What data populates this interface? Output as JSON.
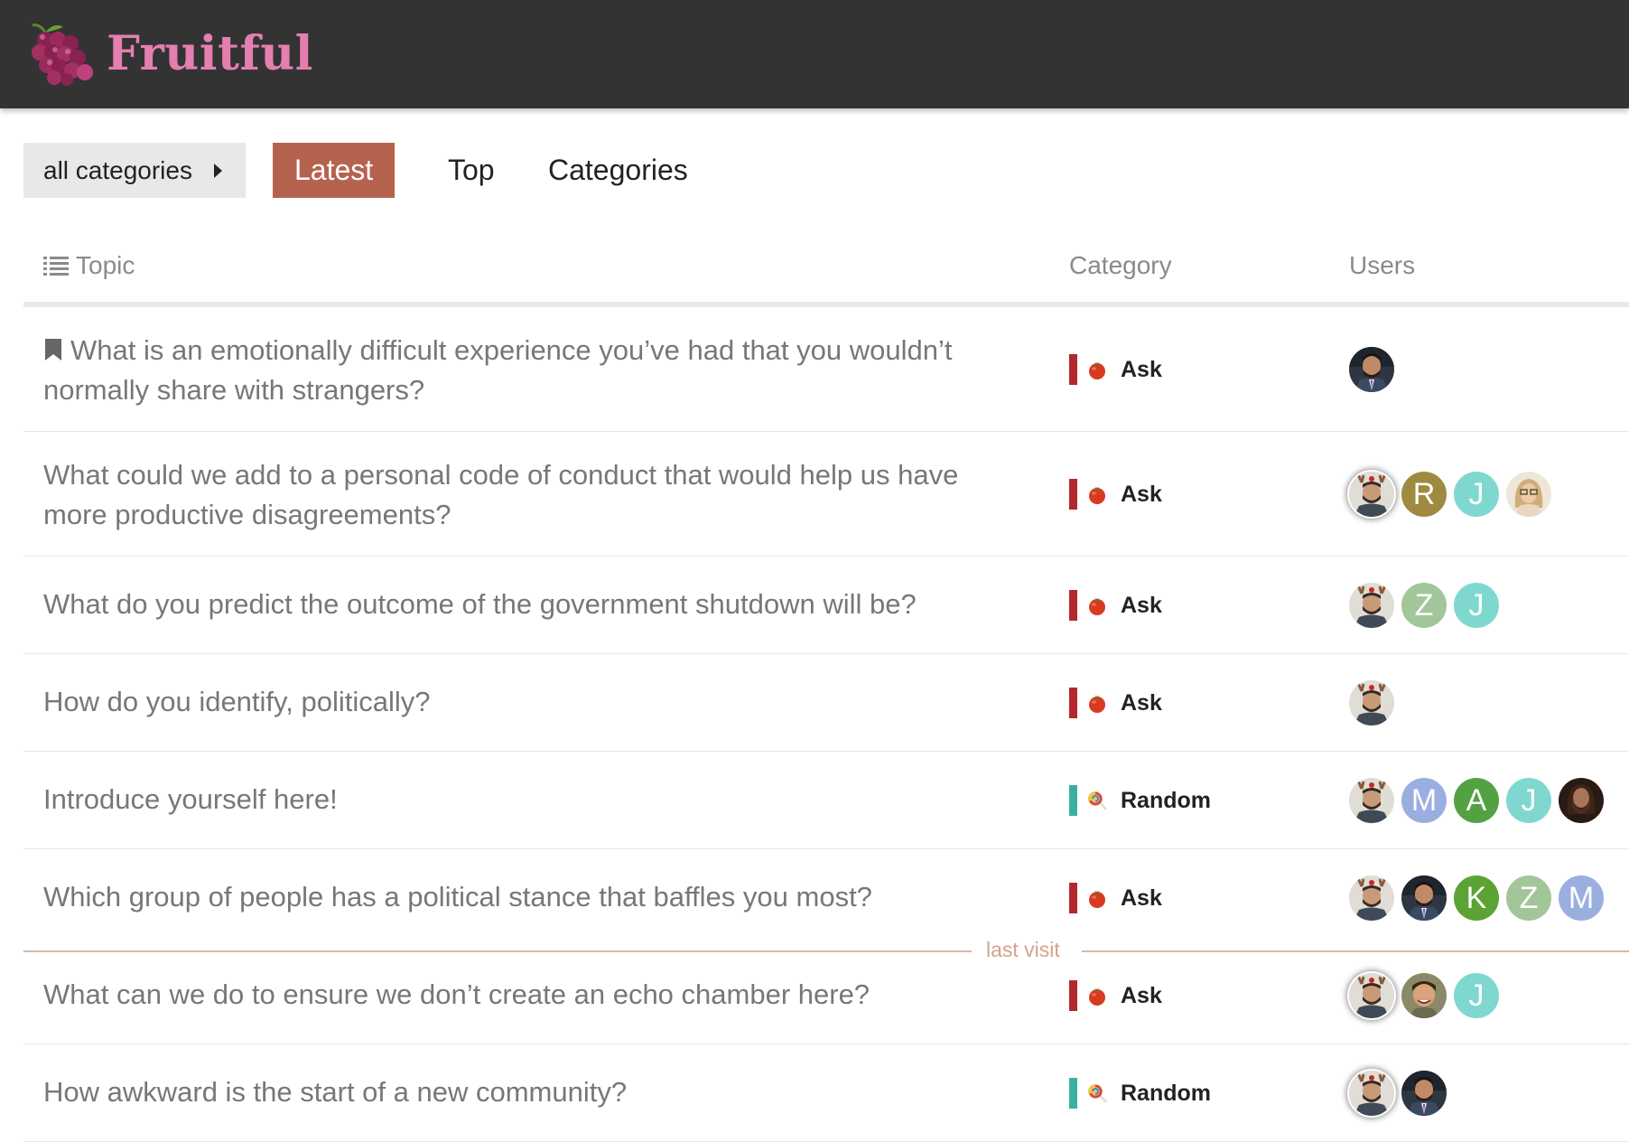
{
  "site": {
    "name": "Fruitful",
    "logo_icon": "grapes-logo",
    "brand_color": "#e47fb0",
    "header_bg": "#333333"
  },
  "nav": {
    "category_filter": "all categories",
    "tabs": [
      {
        "label": "Latest",
        "active": true
      },
      {
        "label": "Top",
        "active": false
      },
      {
        "label": "Categories",
        "active": false
      }
    ],
    "active_color": "#b5634f"
  },
  "table": {
    "headers": {
      "topic": "Topic",
      "category": "Category",
      "users": "Users"
    },
    "last_visit_label": "last visit",
    "topics": [
      {
        "title": "What is an emotionally difficult experience you’ve had that you wouldn’t normally share with strangers?",
        "bookmarked": true,
        "category": "Ask",
        "users": [
          "photo-suit"
        ]
      },
      {
        "title": "What could we add to a personal code of conduct that would help us have more productive disagreements?",
        "bookmarked": false,
        "category": "Ask",
        "users": [
          "photo-antlers-op",
          "R",
          "J",
          "photo-woman"
        ]
      },
      {
        "title": "What do you predict the outcome of the government shutdown will be?",
        "bookmarked": false,
        "category": "Ask",
        "users": [
          "photo-antlers",
          "Z",
          "J"
        ]
      },
      {
        "title": "How do you identify, politically?",
        "bookmarked": false,
        "category": "Ask",
        "users": [
          "photo-antlers"
        ]
      },
      {
        "title": "Introduce yourself here!",
        "bookmarked": false,
        "category": "Random",
        "users": [
          "photo-antlers",
          "M",
          "A",
          "J",
          "photo-beard"
        ]
      },
      {
        "title": "Which group of people has a political stance that baffles you most?",
        "bookmarked": false,
        "category": "Ask",
        "users": [
          "photo-antlers",
          "photo-suit",
          "K",
          "Z",
          "M"
        ]
      },
      {
        "title": "What can we do to ensure we don’t create an echo chamber here?",
        "bookmarked": false,
        "category": "Ask",
        "users": [
          "photo-antlers-op",
          "photo-child",
          "J"
        ]
      },
      {
        "title": "How awkward is the start of a new community?",
        "bookmarked": false,
        "category": "Random",
        "users": [
          "photo-antlers-op",
          "photo-suit"
        ]
      }
    ]
  },
  "categories": {
    "Ask": {
      "color": "#b3282d",
      "icon": "tomato-icon"
    },
    "Random": {
      "color": "#3ab0a2",
      "icon": "lollipop-icon"
    }
  },
  "avatar_colors": {
    "R": "#9e8b3f",
    "J": "#7fd8cf",
    "Z": "#a2c699",
    "M": "#9aaee0",
    "A": "#54a142",
    "K": "#5ba335"
  }
}
